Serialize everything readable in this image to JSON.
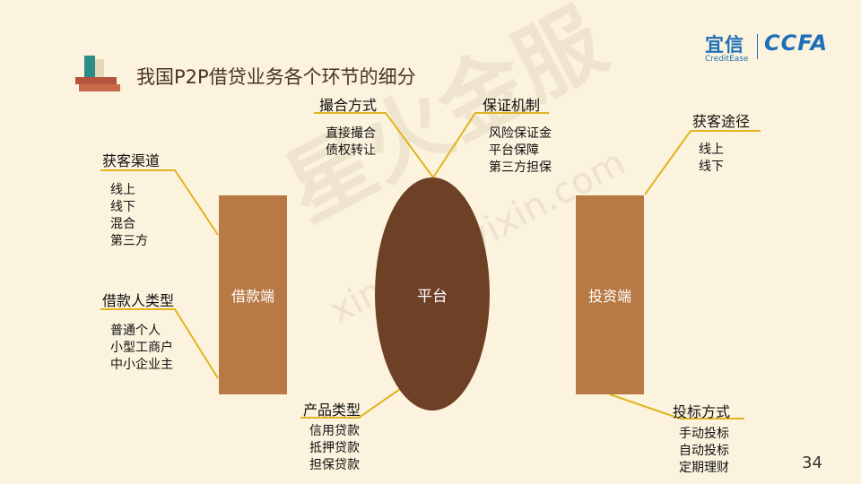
{
  "title": "我国P2P借贷业务各个环节的细分",
  "logo": {
    "cn": "宜信",
    "en": "CreditEase",
    "ccfa": "CCFA"
  },
  "watermark": {
    "cn": "星火金服",
    "en": "xinghuo.yixin.com"
  },
  "nodes": {
    "borrower": "借款端",
    "platform": "平台",
    "investor": "投资端"
  },
  "groups": {
    "acquisition_channel": {
      "heading": "获客渠道",
      "items": [
        "线上",
        "线下",
        "混合",
        "第三方"
      ]
    },
    "borrower_type": {
      "heading": "借款人类型",
      "items": [
        "普通个人",
        "小型工商户",
        "中小企业主"
      ]
    },
    "matching_method": {
      "heading": "撮合方式",
      "items": [
        "直接撮合",
        "债权转让"
      ]
    },
    "guarantee_mechanism": {
      "heading": "保证机制",
      "items": [
        "风险保证金",
        "平台保障",
        "第三方担保"
      ]
    },
    "product_type": {
      "heading": "产品类型",
      "items": [
        "信用贷款",
        "抵押贷款",
        "担保贷款"
      ]
    },
    "acquisition_path": {
      "heading": "获客途径",
      "items": [
        "线上",
        "线下"
      ]
    },
    "bidding_method": {
      "heading": "投标方式",
      "items": [
        "手动投标",
        "自动投标",
        "定期理财"
      ]
    }
  },
  "page_number": "34",
  "colors": {
    "box": "#b87945",
    "oval": "#6e4026",
    "connector": "#e2b420",
    "background": "#fbf3dd",
    "brand": "#1e6fb8"
  }
}
